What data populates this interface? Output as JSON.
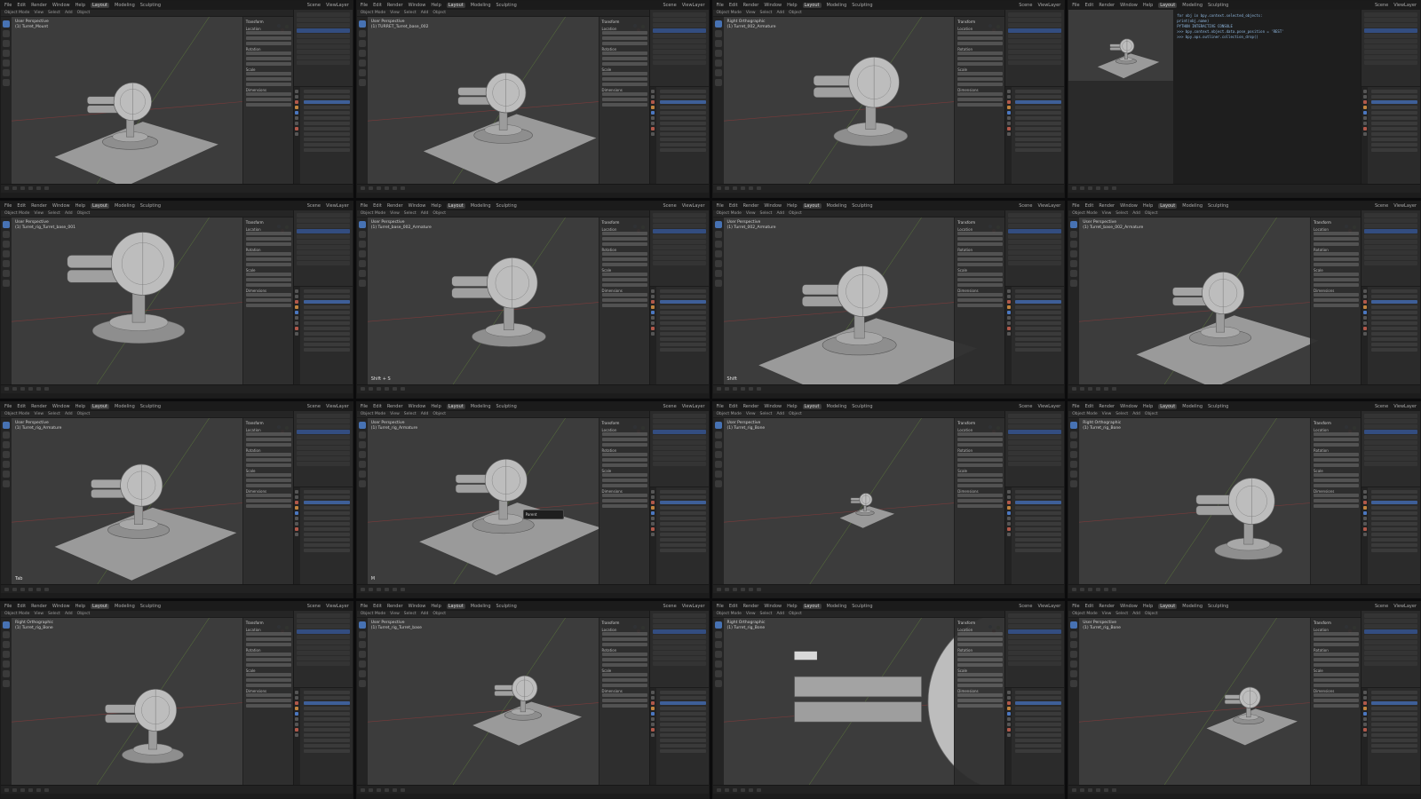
{
  "menu": [
    "File",
    "Edit",
    "Render",
    "Window",
    "Help"
  ],
  "workspace_active": "Layout",
  "workspaces": [
    "Layout",
    "Modeling",
    "Sculpting"
  ],
  "header_modes": [
    "Object Mode",
    "View",
    "Select",
    "Add",
    "Object"
  ],
  "scene_label": "Scene",
  "view_layer_label": "ViewLayer",
  "transform_title": "Transform",
  "transform_fields": [
    "Location",
    "Rotation",
    "Scale",
    "Dimensions"
  ],
  "tiles": [
    {
      "view": "User Perspective",
      "object": "(1) Turret_Mount",
      "hint": ""
    },
    {
      "view": "User Perspective",
      "object": "(1) TURRET_Turret_base_002",
      "hint": ""
    },
    {
      "view": "Right Orthographic",
      "object": "(1) Turret_002_Armature",
      "hint": ""
    },
    {
      "view": "User Perspective",
      "object": "(1) Turret_rig",
      "hint": ""
    },
    {
      "view": "User Perspective",
      "object": "(1) Turret_rig_Turret_base_001",
      "hint": ""
    },
    {
      "view": "User Perspective",
      "object": "(1) Turret_base_002_Armature",
      "hint": "Shift + S"
    },
    {
      "view": "User Perspective",
      "object": "(1) Turret_002_Armature",
      "hint": "Shift"
    },
    {
      "view": "User Perspective",
      "object": "(1) Turret_base_002_Armature",
      "hint": ""
    },
    {
      "view": "User Perspective",
      "object": "(1) Turret_rig_Armature",
      "hint": "Tab"
    },
    {
      "view": "User Perspective",
      "object": "(1) Turret_rig_Armature",
      "hint": "M"
    },
    {
      "view": "User Perspective",
      "object": "(1) Turret_rig_Bone",
      "hint": ""
    },
    {
      "view": "Right Orthographic",
      "object": "(1) Turret_rig_Bone",
      "hint": ""
    },
    {
      "view": "Right Orthographic",
      "object": "(1) Turret_rig_Bone",
      "hint": ""
    },
    {
      "view": "User Perspective",
      "object": "(1) Turret_rig_Turret_base",
      "hint": ""
    },
    {
      "view": "Right Orthographic",
      "object": "(1) Turret_rig_Bone",
      "hint": ""
    },
    {
      "view": "User Perspective",
      "object": "(1) Turret_rig_Bone",
      "hint": ""
    }
  ],
  "script_lines": [
    "for obj in bpy.context.selected_objects:",
    "    print(obj.name)",
    "",
    "PYTHON INTERACTIVE CONSOLE",
    ">>> bpy.context.object.data.pose_position = 'REST'",
    ">>> bpy.ops.outliner.collection_drop()"
  ],
  "popup_label": "Parent",
  "colors": {
    "accent": "#4772b3",
    "viewport_bg": "#3c3c3c",
    "plane": "#9a9a9a",
    "turret": "#bdbdbd"
  }
}
